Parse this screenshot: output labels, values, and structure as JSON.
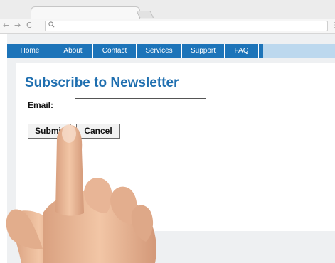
{
  "browser": {
    "nav_icons": {
      "back": "←",
      "forward": "→",
      "reload": "C"
    },
    "address_icon": "search-icon",
    "menu_glyph": "⋮"
  },
  "navbar": {
    "items": [
      {
        "label": "Home"
      },
      {
        "label": "About"
      },
      {
        "label": "Contact"
      },
      {
        "label": "Services"
      },
      {
        "label": "Support"
      },
      {
        "label": "FAQ"
      }
    ]
  },
  "form": {
    "title": "Subscribe to Newsletter",
    "email_label": "Email:",
    "email_value": "",
    "submit_label": "Submit",
    "cancel_label": "Cancel"
  },
  "colors": {
    "nav_bar": "#1d74b9",
    "nav_bar_light": "#bcd8ee",
    "heading": "#1f6fb0"
  }
}
